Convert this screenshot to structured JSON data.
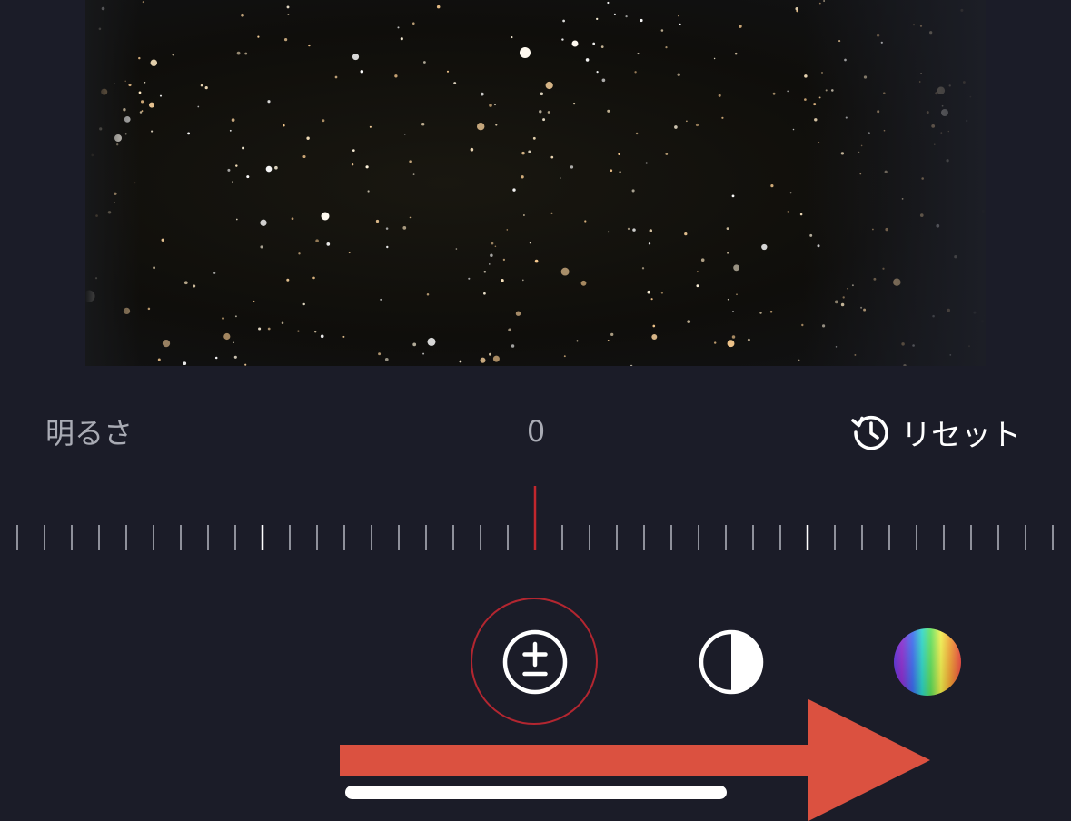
{
  "editor": {
    "adjustment_label": "明るさ",
    "adjustment_value": "0",
    "reset_label": "リセット"
  },
  "slider": {
    "value": 0,
    "min": -100,
    "max": 100,
    "indicator_color": "#c2272d"
  },
  "tools": [
    {
      "id": "exposure",
      "icon": "plus-minus-circle-icon",
      "selected": true
    },
    {
      "id": "contrast",
      "icon": "half-circle-contrast-icon",
      "selected": false
    },
    {
      "id": "color",
      "icon": "spectrum-circle-icon",
      "selected": false
    }
  ],
  "colors": {
    "background": "#1b1c28",
    "accent_red": "#c2272d",
    "annotation_arrow": "#db5140",
    "text_muted": "#a9abb4",
    "text_primary": "#ffffff"
  }
}
